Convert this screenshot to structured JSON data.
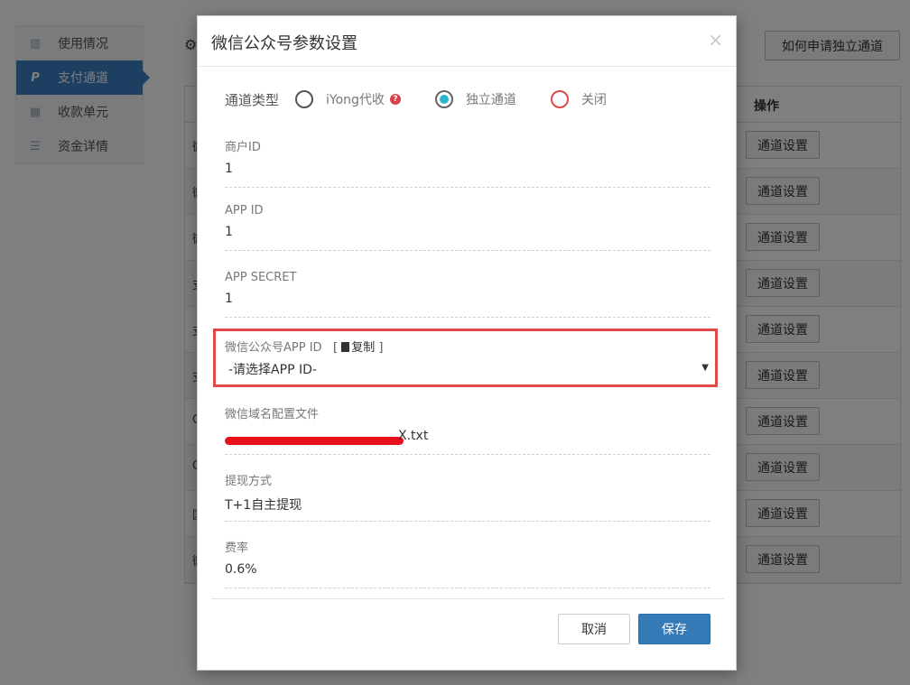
{
  "sidebar": {
    "items": [
      {
        "label": "使用情况",
        "icon": "bar-chart-icon"
      },
      {
        "label": "支付通道",
        "icon": "paypal-icon",
        "active": true
      },
      {
        "label": "收款单元",
        "icon": "grid-icon"
      },
      {
        "label": "资金详情",
        "icon": "list-icon"
      }
    ]
  },
  "background": {
    "apply_button": "如何申请独立通道",
    "table_header_op": "操作",
    "row_button": "通道设置",
    "row_stubs": [
      "微",
      "微",
      "微",
      "支",
      "支",
      "支",
      "Q",
      "Q",
      "国",
      "微"
    ]
  },
  "modal": {
    "title": "微信公众号参数设置",
    "close": "×",
    "channel_type": {
      "label": "通道类型",
      "options": [
        "iYong代收",
        "独立通道",
        "关闭"
      ],
      "selected": "独立通道"
    },
    "merchant_id": {
      "label": "商户ID",
      "value": "1"
    },
    "app_id": {
      "label": "APP ID",
      "value": "1"
    },
    "app_secret": {
      "label": "APP SECRET",
      "value": "1"
    },
    "wechat_app_id": {
      "label": "微信公众号APP ID",
      "copy_open": "[",
      "copy_label": "复制",
      "copy_close": "]",
      "selected_value": "-请选择APP ID-"
    },
    "domain_file": {
      "label": "微信域名配置文件",
      "value_visible_suffix": "X.txt"
    },
    "withdraw": {
      "label": "提现方式",
      "value": "T+1自主提现"
    },
    "fee_rate": {
      "label": "费率",
      "value": "0.6%"
    },
    "cancel_label": "取消",
    "save_label": "保存"
  },
  "colors": {
    "primary": "#337ab7",
    "highlight": "#e24a4a",
    "radio_checked": "#29b6c9",
    "redaction": "#e8101a"
  }
}
